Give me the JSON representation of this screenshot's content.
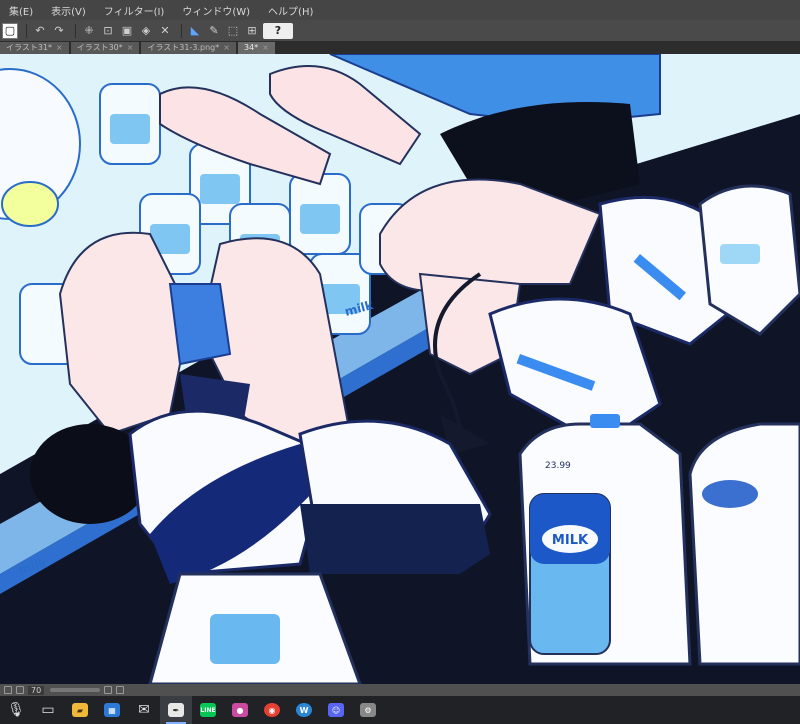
{
  "menu": {
    "items": [
      "集(E)",
      "表示(V)",
      "フィルター(I)",
      "ウィンドウ(W)",
      "ヘルプ(H)"
    ]
  },
  "toolbar": {
    "help_label": "?"
  },
  "tabs": [
    {
      "label": "イラスト31*"
    },
    {
      "label": "イラスト30*"
    },
    {
      "label": "イラスト31-3.png*"
    },
    {
      "label": "34*"
    }
  ],
  "artwork": {
    "milk_label_large": "MILK",
    "milk_label_small": "milk",
    "bottle_price": "23.99",
    "colors": {
      "background": "#dff3fb",
      "blue": "#2f7fe0",
      "navy": "#1d2b5e",
      "dark": "#171b2e",
      "skin": "#f9dfe0",
      "white": "#fbfcff"
    }
  },
  "statusbar": {
    "zoom": "70"
  },
  "taskbar": {
    "icons": [
      "microphone-icon",
      "task-view-icon",
      "file-explorer-icon",
      "store-icon",
      "mail-icon",
      "clip-studio-icon",
      "line-icon",
      "paint-icon",
      "chrome-icon",
      "wacom-icon",
      "discord-icon",
      "settings-icon"
    ],
    "line_label": "LINE",
    "wacom_label": "W"
  }
}
